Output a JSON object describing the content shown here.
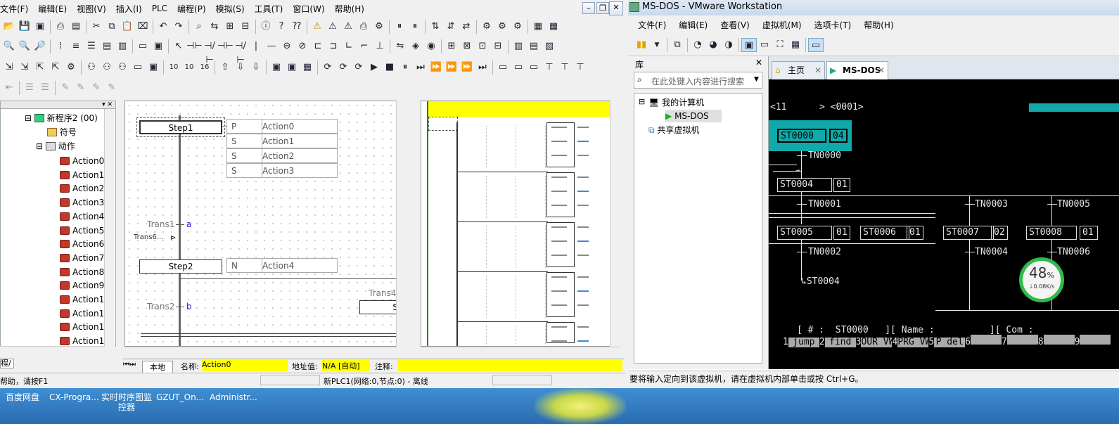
{
  "left_app": {
    "menu": [
      "文件(F)",
      "编辑(E)",
      "视图(V)",
      "插入(I)",
      "PLC",
      "编程(P)",
      "模拟(S)",
      "工具(T)",
      "窗口(W)",
      "帮助(H)"
    ],
    "tree": {
      "root": "新程序2 (00)",
      "symbols": "符号",
      "actions_folder": "动作",
      "items": [
        "Action0",
        "Action1",
        "Action2",
        "Action3",
        "Action4",
        "Action5",
        "Action6",
        "Action7",
        "Action8",
        "Action9",
        "Action1",
        "Action1",
        "Action1",
        "Action1"
      ]
    },
    "sfc": {
      "step1": "Step1",
      "step1_actions": [
        {
          "q": "P",
          "name": "Action0"
        },
        {
          "q": "S",
          "name": "Action1"
        },
        {
          "q": "S",
          "name": "Action2"
        },
        {
          "q": "S",
          "name": "Action3"
        }
      ],
      "trans1": "Trans1",
      "trans1_cond": "a",
      "trans6": "Trans6...",
      "step2": "Step2",
      "step2_actions": [
        {
          "q": "N",
          "name": "Action4"
        }
      ],
      "trans4": "Trans4",
      "trans2": "Trans2",
      "trans2_cond": "b",
      "s_box": "S"
    },
    "tab_left": "程",
    "tab_local": "本地",
    "name_label": "名称:",
    "name_value": "Action0",
    "addr_label": "地址值:",
    "addr_value": "N/A [自动]",
    "comment_label": "注释:",
    "status_help": "帮助，请按F1",
    "status_plc": "新PLC1(网络:0,节点:0) - 离线"
  },
  "right_app": {
    "title": "MS-DOS - VMware Workstation",
    "menu": [
      "文件(F)",
      "编辑(E)",
      "查看(V)",
      "虚拟机(M)",
      "选项卡(T)",
      "帮助(H)"
    ],
    "library_title": "库",
    "search_placeholder": "在此处键入内容进行搜索",
    "my_computer": "我的计算机",
    "vm_name": "MS-DOS",
    "shared_vm": "共享虚拟机",
    "tab_home": "主页",
    "tab_vm": "MS-DOS",
    "status": "要将输入定向到该虚拟机，请在虚拟机内部单击或按 Ctrl+G。",
    "dos": {
      "header_left": "<11",
      "header_right": "> <0001>",
      "st0000": "ST0000",
      "st0000_n": "04",
      "tn0000": "TN0000",
      "st0004": "ST0004",
      "st0004_n": "01",
      "tn0001": "TN0001",
      "tn0003": "TN0003",
      "tn0005": "TN0005",
      "st0005": "ST0005",
      "st0005_n": "01",
      "st0006": "ST0006",
      "st0006_n": "01",
      "st0007": "ST0007",
      "st0007_n": "02",
      "st0008": "ST0008",
      "st0008_n": "01",
      "tn0002": "TN0002",
      "tn0004": "TN0004",
      "tn0006": "TN0006",
      "jump_to": "ST0004",
      "status_line": "[ # :  ST0000   ][ Name :          ][ Com :",
      "fkeys": [
        {
          "n": "1",
          "label": "jump"
        },
        {
          "n": "2",
          "label": "find"
        },
        {
          "n": "3",
          "label": "OUR VW"
        },
        {
          "n": "4",
          "label": "PRG VW"
        },
        {
          "n": "5",
          "label": "P del"
        },
        {
          "n": "6",
          "label": ""
        },
        {
          "n": "7",
          "label": ""
        },
        {
          "n": "8",
          "label": ""
        },
        {
          "n": "9",
          "label": ""
        }
      ]
    },
    "net_percent": "48",
    "net_percent_unit": "%",
    "net_speed": "0.08K/s"
  },
  "taskbar": {
    "items": [
      "百度网盘",
      "CX-Progra...",
      "实时时序图监\n控器",
      "GZUT_On...",
      "Administr..."
    ]
  }
}
